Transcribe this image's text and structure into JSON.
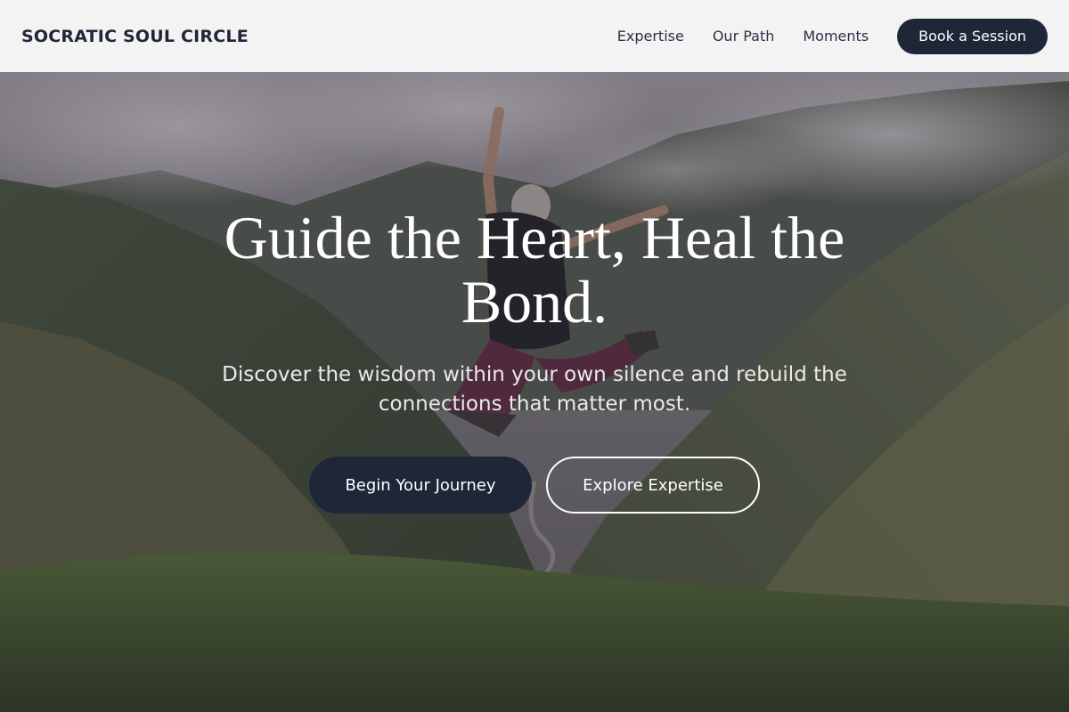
{
  "brand": {
    "name": "SOCRATIC SOUL CIRCLE"
  },
  "nav": {
    "links": [
      {
        "label": "Expertise"
      },
      {
        "label": "Our Path"
      },
      {
        "label": "Moments"
      }
    ],
    "cta_label": "Book a Session"
  },
  "hero": {
    "headline": "Guide the Heart, Heal the Bond.",
    "subline": "Discover the wisdom within your own silence and rebuild the connections that matter most.",
    "primary_cta": "Begin Your Journey",
    "secondary_cta": "Explore Expertise"
  },
  "colors": {
    "accent": "#1e2638",
    "nav_bg": "#f3f3f3",
    "text_light": "#ffffff"
  }
}
